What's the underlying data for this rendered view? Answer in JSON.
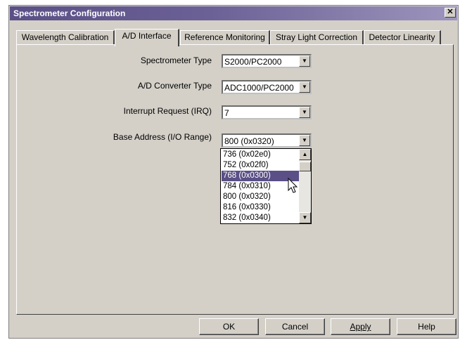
{
  "window": {
    "title": "Spectrometer Configuration",
    "close_label": "✕"
  },
  "tabs": [
    {
      "label": "Wavelength Calibration",
      "active": false
    },
    {
      "label": "A/D Interface",
      "active": true
    },
    {
      "label": "Reference Monitoring",
      "active": false
    },
    {
      "label": "Stray Light Correction",
      "active": false
    },
    {
      "label": "Detector Linearity",
      "active": false
    }
  ],
  "form": {
    "spectrometer_type": {
      "label": "Spectrometer Type",
      "value": "S2000/PC2000"
    },
    "ad_converter_type": {
      "label": "A/D Converter Type",
      "value": "ADC1000/PC2000"
    },
    "interrupt_request": {
      "label": "Interrupt Request (IRQ)",
      "value": "7"
    },
    "base_address": {
      "label": "Base Address (I/O Range)",
      "value": "800 (0x0320)",
      "options": [
        "736 (0x02e0)",
        "752 (0x02f0)",
        "768 (0x0300)",
        "784 (0x0310)",
        "800 (0x0320)",
        "816 (0x0330)",
        "832 (0x0340)"
      ],
      "highlighted": "768 (0x0300)"
    }
  },
  "buttons": {
    "ok": "OK",
    "cancel": "Cancel",
    "apply": "Apply",
    "help": "Help"
  },
  "colors": {
    "title_bar": "#5a4f86",
    "selection": "#5a4f86",
    "face": "#d4d0c8"
  },
  "icons": {
    "dropdown": "down-triangle",
    "scroll_up": "up-triangle",
    "scroll_down": "down-triangle",
    "cursor": "arrow-pointer"
  }
}
